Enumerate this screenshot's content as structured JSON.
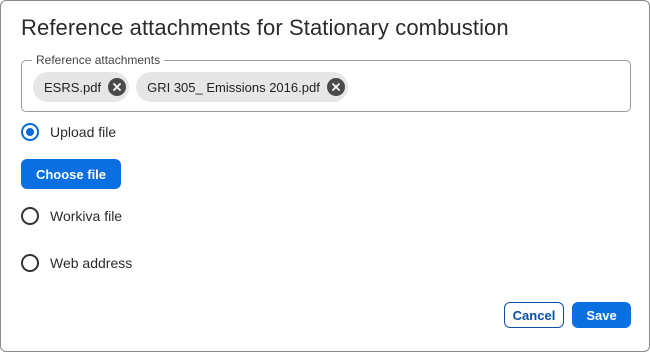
{
  "dialog": {
    "title": "Reference attachments for Stationary combustion"
  },
  "attachments": {
    "legend": "Reference attachments",
    "chips": [
      {
        "label": "ESRS.pdf"
      },
      {
        "label": "GRI 305_ Emissions 2016.pdf"
      }
    ]
  },
  "source_options": {
    "selected": "Upload file",
    "options": [
      {
        "label": "Upload file"
      },
      {
        "label": "Workiva file"
      },
      {
        "label": "Web address"
      }
    ]
  },
  "upload": {
    "choose_file_label": "Choose file"
  },
  "footer": {
    "cancel_label": "Cancel",
    "save_label": "Save"
  },
  "colors": {
    "accent": "#0a6fe0",
    "chip_bg": "#e6e6e6",
    "chip_close": "#4a4a4a"
  },
  "icons": {
    "chip_remove": "close-circle-icon"
  }
}
